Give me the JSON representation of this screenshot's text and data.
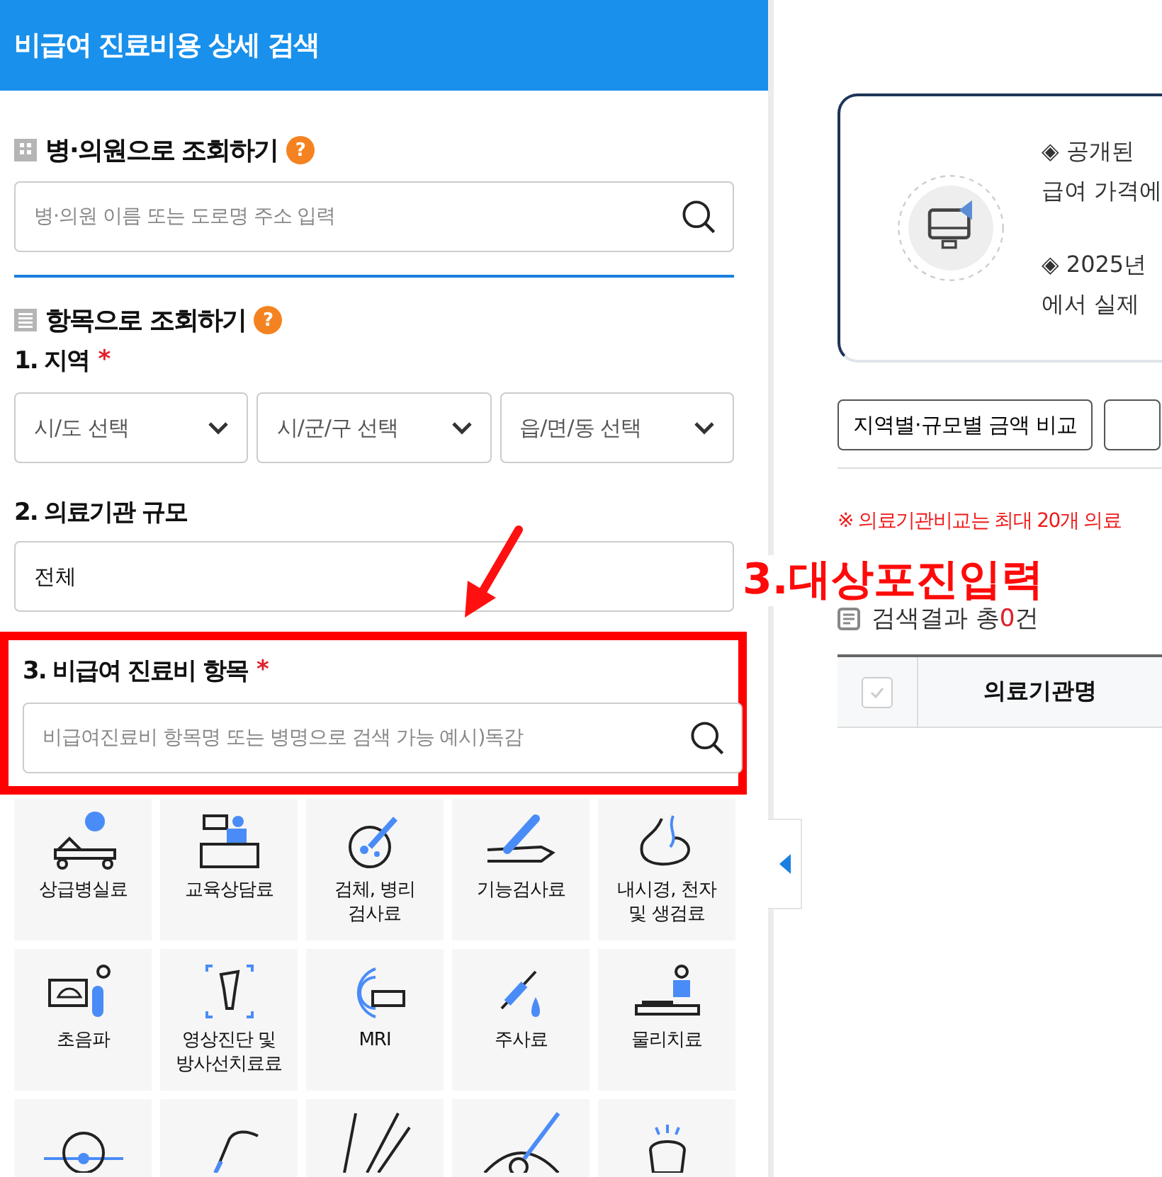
{
  "header": {
    "title": "비급여 진료비용 상세 검색"
  },
  "hospital_search": {
    "heading": "병·의원으로 조회하기",
    "help": "?",
    "placeholder": "병·의원 이름 또는 도로명 주소 입력"
  },
  "item_search": {
    "heading": "항목으로 조회하기",
    "help": "?",
    "region": {
      "label": "1. 지역",
      "required_mark": "*",
      "selects": [
        "시/도 선택",
        "시/군/구 선택",
        "읍/면/동 선택"
      ]
    },
    "scale": {
      "label": "2. 의료기관 규모",
      "value": "전체"
    },
    "item": {
      "label": "3. 비급여 진료비 항목",
      "required_mark": "*",
      "placeholder": "비급여진료비 항목명 또는 병명으로 검색 가능 예시)독감",
      "highlighted": true
    },
    "categories": [
      {
        "kind": "labeled",
        "lines": [
          "상급병실료"
        ]
      },
      {
        "kind": "labeled",
        "lines": [
          "교육상담료"
        ]
      },
      {
        "kind": "labeled",
        "lines": [
          "검체, 병리",
          "검사료"
        ]
      },
      {
        "kind": "labeled",
        "lines": [
          "기능검사료"
        ]
      },
      {
        "kind": "labeled",
        "lines": [
          "내시경, 천자",
          "및 생검료"
        ]
      },
      {
        "kind": "labeled",
        "lines": [
          "초음파"
        ]
      },
      {
        "kind": "labeled",
        "lines": [
          "영상진단 및",
          "방사선치료료"
        ]
      },
      {
        "kind": "labeled",
        "lines": [
          "MRI"
        ]
      },
      {
        "kind": "labeled",
        "lines": [
          "주사료"
        ]
      },
      {
        "kind": "labeled",
        "lines": [
          "물리치료"
        ]
      },
      {
        "kind": "icon"
      },
      {
        "kind": "icon"
      },
      {
        "kind": "icon"
      },
      {
        "kind": "icon"
      },
      {
        "kind": "icon"
      }
    ]
  },
  "annotation": {
    "text": "3.대상포진입력"
  },
  "info_card": {
    "paragraphs": [
      [
        "◈ 공개된",
        "급여 가격에"
      ],
      [
        "◈ 2025년",
        "에서 실제"
      ]
    ]
  },
  "buttons": [
    "지역별·규모별 금액 비교"
  ],
  "notice": "※ 의료기관비교는 최대 20개 의료",
  "results": {
    "prefix": "검색결과 총",
    "count": "0",
    "suffix": "건"
  },
  "table": {
    "columns": [
      "의료기관명"
    ],
    "select_all": {
      "disabled": true
    }
  }
}
